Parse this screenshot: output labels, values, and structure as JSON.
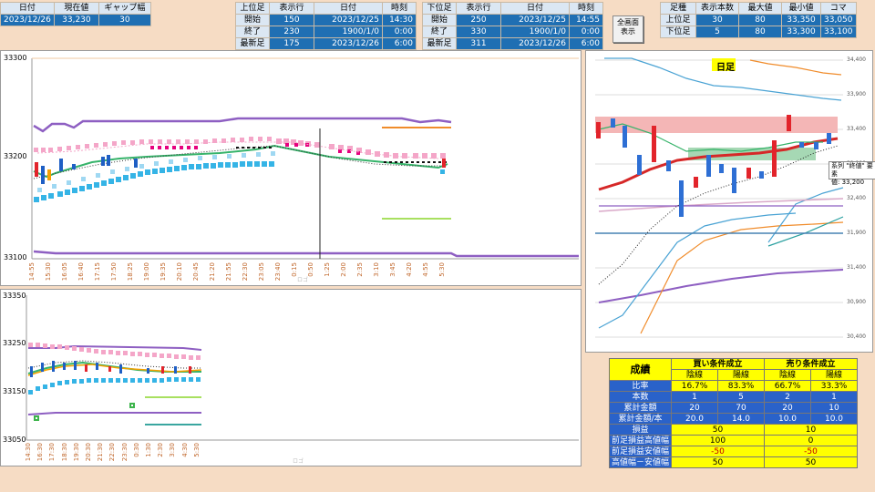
{
  "top_left": {
    "headers": [
      "日付",
      "現在値",
      "ギャップ幅"
    ],
    "values": [
      "2023/12/26",
      "33,230",
      "30"
    ]
  },
  "upper_info": {
    "headers": [
      "上位足",
      "表示行",
      "日付",
      "時刻"
    ],
    "rows": [
      [
        "開始",
        "150",
        "2023/12/25",
        "14:30"
      ],
      [
        "終了",
        "230",
        "1900/1/0",
        "0:00"
      ],
      [
        "最新足",
        "175",
        "2023/12/26",
        "6:00"
      ]
    ]
  },
  "lower_info": {
    "headers": [
      "下位足",
      "表示行",
      "日付",
      "時刻"
    ],
    "rows": [
      [
        "開始",
        "250",
        "2023/12/25",
        "14:55"
      ],
      [
        "終了",
        "330",
        "1900/1/0",
        "0:00"
      ],
      [
        "最新足",
        "311",
        "2023/12/26",
        "6:00"
      ]
    ]
  },
  "fullscreen_button": {
    "line1": "全画面",
    "line2": "表示"
  },
  "right_info": {
    "headers": [
      "足種",
      "表示本数",
      "最大値",
      "最小値",
      "コマ"
    ],
    "rows": [
      [
        "上位足",
        "30",
        "80",
        "33,350",
        "33,050"
      ],
      [
        "下位足",
        "5",
        "80",
        "33,300",
        "33,100"
      ]
    ]
  },
  "chart_upper": {
    "y_ticks": [
      "33300",
      "33200",
      "33100"
    ],
    "x_ticks": [
      "14:55",
      "15:30",
      "16:05",
      "16:40",
      "17:15",
      "17:50",
      "18:25",
      "19:00",
      "19:35",
      "20:10",
      "20:45",
      "21:20",
      "21:55",
      "22:30",
      "23:05",
      "23:40",
      "0:15",
      "0:50",
      "1:25",
      "2:00",
      "2:35",
      "3:10",
      "3:45",
      "4:20",
      "4:55",
      "5:30"
    ],
    "watermark": "ロゴ"
  },
  "chart_lower": {
    "y_ticks": [
      "33350",
      "33250",
      "33150",
      "33050"
    ],
    "x_ticks": [
      "14:30",
      "16:30",
      "17:30",
      "18:30",
      "19:30",
      "20:30",
      "21:30",
      "22:30",
      "23:30",
      "0:30",
      "1:30",
      "2:30",
      "3:30",
      "4:30",
      "5:30"
    ],
    "watermark": "ロゴ"
  },
  "chart_daily": {
    "label": "日足",
    "y_ticks": [
      "34,400",
      "33,900",
      "33,400",
      "32,900",
      "32,400",
      "31,900",
      "31,400",
      "30,900",
      "30,400"
    ],
    "tooltip": {
      "line1": "系列 \"終値\" 要素",
      "line2": "値: 33,200"
    }
  },
  "stats": {
    "title": "成績",
    "buy_header": "買い条件成立",
    "sell_header": "売り条件成立",
    "sub": [
      "陰線",
      "陽線",
      "陰線",
      "陽線"
    ],
    "rows": [
      {
        "label": "比率",
        "vals": [
          "16.7%",
          "83.3%",
          "66.7%",
          "33.3%"
        ]
      },
      {
        "label": "本数",
        "vals": [
          "1",
          "5",
          "2",
          "1"
        ]
      },
      {
        "label": "累計金額",
        "vals": [
          "20",
          "70",
          "20",
          "10"
        ]
      },
      {
        "label": "累計金額/本",
        "vals": [
          "20.0",
          "14.0",
          "10.0",
          "10.0"
        ]
      }
    ],
    "merged": [
      {
        "label": "損益",
        "buy": "50",
        "sell": "10"
      },
      {
        "label": "前足損益高値幅",
        "buy": "100",
        "sell": "0"
      },
      {
        "label": "前足損益安値幅",
        "buy": "-50",
        "sell": "-50"
      },
      {
        "label": "高値幅－安値幅",
        "buy": "50",
        "sell": "50"
      }
    ]
  },
  "colors": {
    "cell_blue": "#1f6fb3",
    "chart_pink": "#f4a6c8",
    "chart_cyan": "#35b4e6",
    "chart_purple": "#8e5fc2",
    "stats_yellow": "#ffff00"
  }
}
